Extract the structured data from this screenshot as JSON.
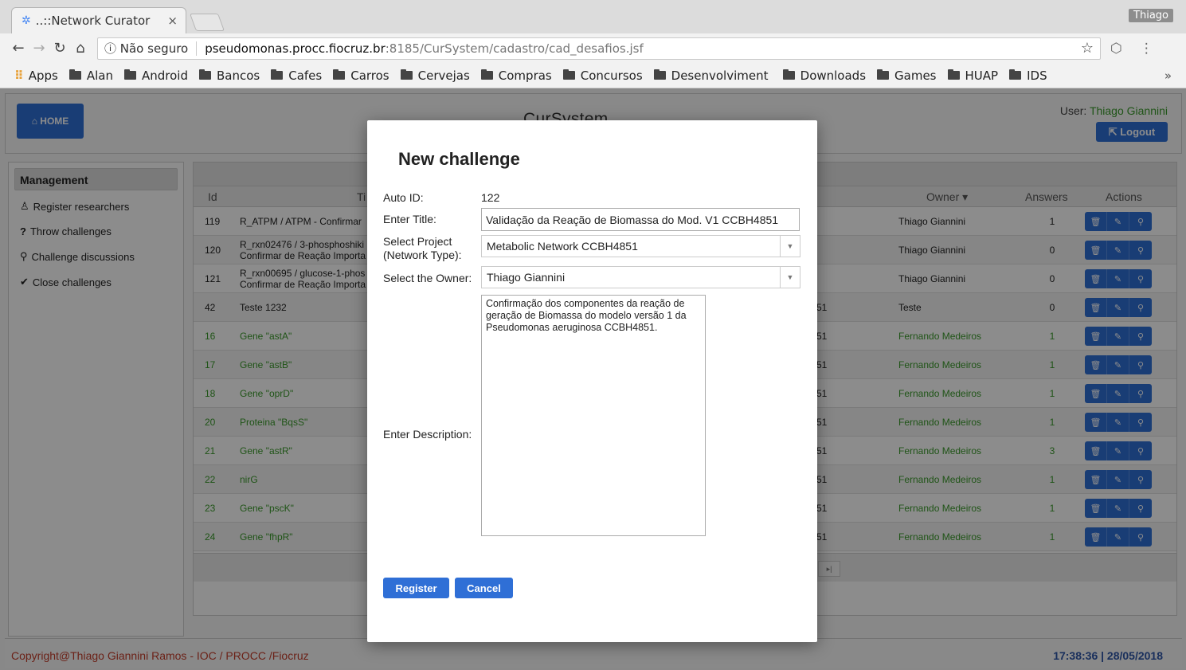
{
  "browser": {
    "tab_title": "..::Network Curator",
    "tab_close": "×",
    "profile_name": "Thiago",
    "security_label": "ⓘ Não seguro",
    "url_host": "pseudomonas.procc.fiocruz.br",
    "url_path": ":8185/CurSystem/cadastro/cad_desafios.jsf",
    "bookmarks": [
      "Apps",
      "Alan",
      "Android",
      "Bancos",
      "Cafes",
      "Carros",
      "Cervejas",
      "Compras",
      "Concursos",
      "Desenvolviment",
      "Downloads",
      "Games",
      "HUAP",
      "IDS"
    ],
    "bookmarks_more": "»"
  },
  "header": {
    "home_label": "⌂ HOME",
    "logo": "CurSystem",
    "user_prefix": "User: ",
    "user_name": "Thiago Giannini",
    "logout_label": "⇱ Logout"
  },
  "sidebar": {
    "title": "Management",
    "items": [
      {
        "icon": "♙",
        "label": "Register researchers"
      },
      {
        "icon": "?",
        "label": "Throw challenges"
      },
      {
        "icon": "⚲",
        "label": "Challenge discussions"
      },
      {
        "icon": "✔",
        "label": "Close challenges"
      }
    ]
  },
  "table": {
    "headers": {
      "id": "Id",
      "title": "Ti",
      "owner": "Owner ▾",
      "answers": "Answers",
      "actions": "Actions"
    },
    "rows": [
      {
        "id": "119",
        "title": "R_ATPM / ATPM - Confirmar",
        "title2": "",
        "mid": "",
        "owner": "Thiago Giannini",
        "answers": "1",
        "green": false
      },
      {
        "id": "120",
        "title": "R_rxn02476 / 3-phosphoshiki",
        "title2": "Confirmar de Reação Importa",
        "mid": "",
        "owner": "Thiago Giannini",
        "answers": "0",
        "green": false
      },
      {
        "id": "121",
        "title": "R_rxn00695 / glucose-1-phos",
        "title2": "Confirmar de Reação Importa",
        "mid": "",
        "owner": "Thiago Giannini",
        "answers": "0",
        "green": false
      },
      {
        "id": "42",
        "title": "Teste 1232",
        "title2": "",
        "mid": "51",
        "owner": "Teste",
        "answers": "0",
        "green": false
      },
      {
        "id": "16",
        "title": "Gene \"astA\"",
        "title2": "",
        "mid": "51",
        "owner": "Fernando Medeiros",
        "answers": "1",
        "green": true
      },
      {
        "id": "17",
        "title": "Gene \"astB\"",
        "title2": "",
        "mid": "51",
        "owner": "Fernando Medeiros",
        "answers": "1",
        "green": true
      },
      {
        "id": "18",
        "title": "Gene \"oprD\"",
        "title2": "",
        "mid": "51",
        "owner": "Fernando Medeiros",
        "answers": "1",
        "green": true
      },
      {
        "id": "20",
        "title": "Proteina \"BqsS\"",
        "title2": "",
        "mid": "51",
        "owner": "Fernando Medeiros",
        "answers": "1",
        "green": true
      },
      {
        "id": "21",
        "title": "Gene \"astR\"",
        "title2": "",
        "mid": "51",
        "owner": "Fernando Medeiros",
        "answers": "3",
        "green": true
      },
      {
        "id": "22",
        "title": "nirG",
        "title2": "",
        "mid": "51",
        "owner": "Fernando Medeiros",
        "answers": "1",
        "green": true
      },
      {
        "id": "23",
        "title": "Gene \"pscK\"",
        "title2": "",
        "mid": "51",
        "owner": "Fernando Medeiros",
        "answers": "1",
        "green": true
      },
      {
        "id": "24",
        "title": "Gene \"fhpR\"",
        "title2": "",
        "mid": "51",
        "owner": "Fernando Medeiros",
        "answers": "1",
        "green": true
      }
    ],
    "pager_last": "▸|"
  },
  "footer": {
    "copyright": "Copyright@Thiago Giannini Ramos - IOC / PROCC /Fiocruz",
    "clock": "17:38:36 | 28/05/2018"
  },
  "modal": {
    "title": "New challenge",
    "auto_id_label": "Auto ID:",
    "auto_id_value": "122",
    "title_label": "Enter Title:",
    "title_value": "Validação da Reação de Biomassa do Mod. V1 CCBH4851",
    "project_label_1": "Select Project",
    "project_label_2": "(Network Type):",
    "project_value": "Metabolic Network CCBH4851",
    "owner_label": "Select the Owner:",
    "owner_value": "Thiago Giannini",
    "description_label": "Enter Description:",
    "description_value": "Confirmação dos componentes da reação de geração de Biomassa do modelo versão 1 da Pseudomonas aeruginosa CCBH4851.",
    "register_label": "Register",
    "cancel_label": "Cancel"
  }
}
